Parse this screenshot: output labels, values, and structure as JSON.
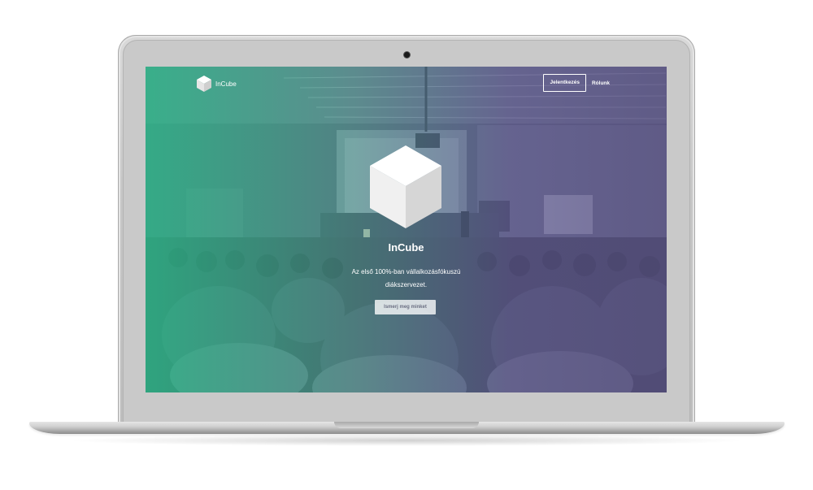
{
  "site": {
    "logo_text": "InCube",
    "nav": {
      "register_label": "Jelentkezés",
      "about_label": "Rólunk"
    },
    "hero": {
      "title": "InCube",
      "subtitle_line1": "Az első 100%-ban vállalkozásfókuszú",
      "subtitle_line2": "diákszervezet.",
      "cta_label": "Ismerj meg minket"
    }
  },
  "icons": {
    "logo": "cube-icon",
    "hero": "cube-icon"
  },
  "colors": {
    "gradient_left": "#2cbe8c",
    "gradient_right": "#5a5287",
    "text": "#ffffff"
  }
}
